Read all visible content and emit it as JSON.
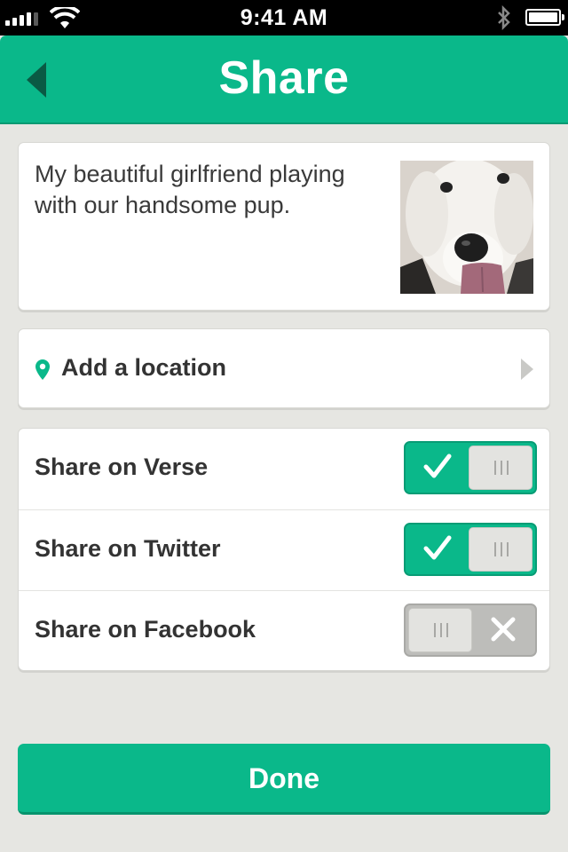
{
  "status_bar": {
    "time": "9:41 AM",
    "signal_icon": "signal-bars-icon",
    "wifi_icon": "wifi-icon",
    "bluetooth_icon": "bluetooth-icon",
    "battery_icon": "battery-icon"
  },
  "header": {
    "title": "Share",
    "back_icon": "back-arrow-icon"
  },
  "caption": {
    "text": "My beautiful girlfriend playing with our handsome pup.",
    "thumbnail": "dog-photo"
  },
  "location": {
    "label": "Add a location",
    "icon": "location-pin-icon",
    "chevron_icon": "chevron-right-icon"
  },
  "share_options": [
    {
      "label": "Share on Verse",
      "enabled": true
    },
    {
      "label": "Share on Twitter",
      "enabled": true
    },
    {
      "label": "Share on Facebook",
      "enabled": false
    }
  ],
  "done_label": "Done",
  "colors": {
    "accent": "#0ab88a",
    "background": "#e6e6e2",
    "card": "#ffffff",
    "toggle_off": "#bdbdba"
  }
}
